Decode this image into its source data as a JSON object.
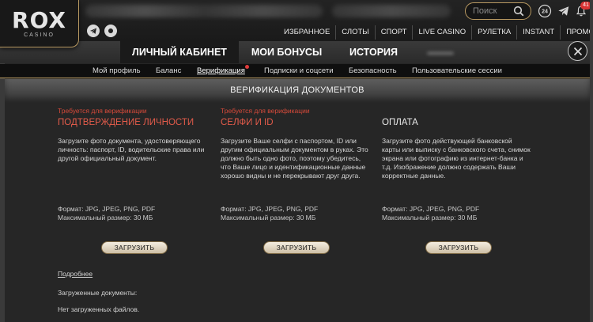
{
  "header": {
    "logo": "ROX",
    "logo_sub": "CASINO",
    "search_placeholder": "Поиск",
    "badge_count": "41"
  },
  "main_nav": [
    "ИЗБРАННОЕ",
    "СЛОТЫ",
    "СПОРТ",
    "LIVE CASINO",
    "РУЛЕТКА",
    "INSTANT",
    "ПРОМО"
  ],
  "cabinet_tabs": [
    "ЛИЧНЫЙ КАБИНЕТ",
    "МОИ БОНУСЫ",
    "ИСТОРИЯ"
  ],
  "sub_nav": [
    "Мой профиль",
    "Баланс",
    "Верификация",
    "Подписки и соцсети",
    "Безопасность",
    "Пользовательские сессии"
  ],
  "section_title": "ВЕРИФИКАЦИЯ ДОКУМЕНТОВ",
  "columns": [
    {
      "required": "Требуется для верификации",
      "title": "ПОДТВЕРЖДЕНИЕ ЛИЧНОСТИ",
      "description": "Загрузите фото документа, удостоверяющего личность: паспорт, ID, водительские права или другой официальный документ.",
      "format": "Формат: JPG, JPEG, PNG, PDF",
      "max_size": "Максимальный размер: 30 МБ",
      "button": "ЗАГРУЗИТЬ"
    },
    {
      "required": "Требуется для верификации",
      "title": "СЕЛФИ И ID",
      "description": "Загрузите Ваше селфи с паспортом, ID или другим официальным документом в руках. Это должно быть одно фото, поэтому убедитесь, что Ваше лицо и идентификационные данные хорошо видны и не перекрывают друг друга.",
      "format": "Формат: JPG, JPEG, PNG, PDF",
      "max_size": "Максимальный размер: 30 МБ",
      "button": "ЗАГРУЗИТЬ"
    },
    {
      "required": "",
      "title": "ОПЛАТА",
      "description": "Загрузите фото действующей банковской карты или выписку с банковского счета, снимок экрана или фотографию из интернет-банка и т.д. Изображение должно содержать Ваши корректные данные.",
      "format": "Формат: JPG, JPEG, PNG, PDF",
      "max_size": "Максимальный размер: 30 МБ",
      "button": "ЗАГРУЗИТЬ"
    }
  ],
  "more_link": "Подробнее",
  "uploaded_label": "Загруженные документы:",
  "no_files": "Нет загруженных файлов.",
  "colors": {
    "accent_gold": "#b99a62",
    "required_red": "#d64a3a",
    "badge_red": "#d93333",
    "background": "#262626"
  },
  "icons": [
    "telegram-icon",
    "circle-icon",
    "search-icon",
    "support-24-icon",
    "telegram-icon",
    "bell-icon",
    "close-icon"
  ]
}
